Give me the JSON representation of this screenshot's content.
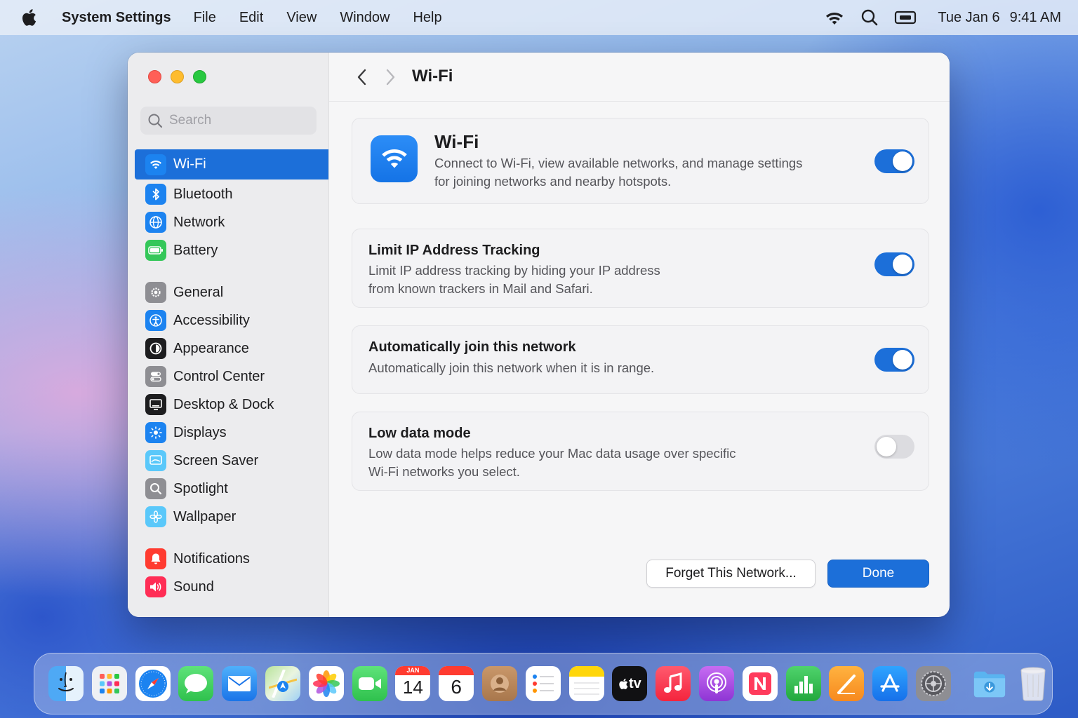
{
  "menubar": {
    "app_name": "System Settings",
    "items": [
      "File",
      "Edit",
      "View",
      "Window",
      "Help"
    ],
    "date": "Tue Jan 6",
    "time": "9:41 AM",
    "icons": [
      "wifi-icon",
      "search-icon",
      "screen-mirroring-icon"
    ]
  },
  "sidebar": {
    "search_placeholder": "Search",
    "groups": [
      [
        {
          "label": "Wi-Fi",
          "icon": "wifi-icon",
          "color": "#1c83f0",
          "selected": true
        },
        {
          "label": "Bluetooth",
          "icon": "bluetooth-icon",
          "color": "#1c83f0"
        },
        {
          "label": "Network",
          "icon": "globe-icon",
          "color": "#1c83f0"
        },
        {
          "label": "Battery",
          "icon": "battery-icon",
          "color": "#34c759"
        }
      ],
      [
        {
          "label": "General",
          "icon": "gear-icon",
          "color": "#8e8e93"
        },
        {
          "label": "Accessibility",
          "icon": "accessibility-icon",
          "color": "#1c83f0"
        },
        {
          "label": "Appearance",
          "icon": "appearance-icon",
          "color": "#1d1d1f"
        },
        {
          "label": "Control Center",
          "icon": "control-center-icon",
          "color": "#8e8e93"
        },
        {
          "label": "Desktop & Dock",
          "icon": "desktop-dock-icon",
          "color": "#1d1d1f"
        },
        {
          "label": "Displays",
          "icon": "displays-icon",
          "color": "#1c83f0"
        },
        {
          "label": "Screen Saver",
          "icon": "screen-saver-icon",
          "color": "#5ac8fa"
        },
        {
          "label": "Spotlight",
          "icon": "spotlight-icon",
          "color": "#8e8e93"
        },
        {
          "label": "Wallpaper",
          "icon": "wallpaper-icon",
          "color": "#5ac8fa"
        }
      ],
      [
        {
          "label": "Notifications",
          "icon": "notifications-icon",
          "color": "#ff3b30"
        },
        {
          "label": "Sound",
          "icon": "sound-icon",
          "color": "#ff2d55"
        }
      ]
    ]
  },
  "header": {
    "title": "Wi-Fi"
  },
  "cards": {
    "wifi": {
      "title": "Wi-Fi",
      "desc_line1": "Connect to Wi-Fi, view available networks, and manage settings",
      "desc_line2": "for joining networks and nearby hotspots.",
      "enabled": true
    },
    "limit_ip": {
      "title": "Limit IP Address Tracking",
      "desc_line1": "Limit IP address tracking by hiding your IP address",
      "desc_line2": "from known trackers in Mail and Safari.",
      "enabled": true
    },
    "auto_join": {
      "title": "Automatically join this network",
      "desc_line1": "Automatically join this network when it is in range.",
      "enabled": true
    },
    "low_data": {
      "title": "Low data mode",
      "desc_line1": "Low data mode helps reduce your Mac data usage over specific",
      "desc_line2": "Wi-Fi networks you select.",
      "enabled": false
    }
  },
  "buttons": {
    "forget": "Forget This Network...",
    "done": "Done"
  },
  "dock": {
    "apps": [
      {
        "name": "Finder",
        "icon": "finder-icon"
      },
      {
        "name": "Launchpad",
        "icon": "launchpad-icon"
      },
      {
        "name": "Safari",
        "icon": "safari-icon"
      },
      {
        "name": "Messages",
        "icon": "messages-icon"
      },
      {
        "name": "Mail",
        "icon": "mail-icon"
      },
      {
        "name": "Maps",
        "icon": "maps-icon"
      },
      {
        "name": "Photos",
        "icon": "photos-icon"
      },
      {
        "name": "FaceTime",
        "icon": "facetime-icon"
      },
      {
        "name": "Calendar",
        "icon": "calendar-icon",
        "month": "JAN",
        "day": "14"
      },
      {
        "name": "Calendar",
        "icon": "calendar-icon",
        "day": "6"
      },
      {
        "name": "Contacts",
        "icon": "contacts-icon"
      },
      {
        "name": "Reminders",
        "icon": "reminders-icon"
      },
      {
        "name": "Notes",
        "icon": "notes-icon"
      },
      {
        "name": "TV",
        "icon": "apple-tv-icon",
        "label": "tv"
      },
      {
        "name": "Music",
        "icon": "music-icon"
      },
      {
        "name": "Podcasts",
        "icon": "podcasts-icon"
      },
      {
        "name": "News",
        "icon": "news-icon"
      },
      {
        "name": "Numbers",
        "icon": "numbers-icon"
      },
      {
        "name": "Pages",
        "icon": "pages-icon"
      },
      {
        "name": "App Store",
        "icon": "app-store-icon"
      },
      {
        "name": "System Settings",
        "icon": "system-settings-icon"
      }
    ],
    "extras": [
      {
        "name": "Downloads",
        "icon": "downloads-folder-icon"
      },
      {
        "name": "Trash",
        "icon": "trash-icon"
      }
    ]
  }
}
